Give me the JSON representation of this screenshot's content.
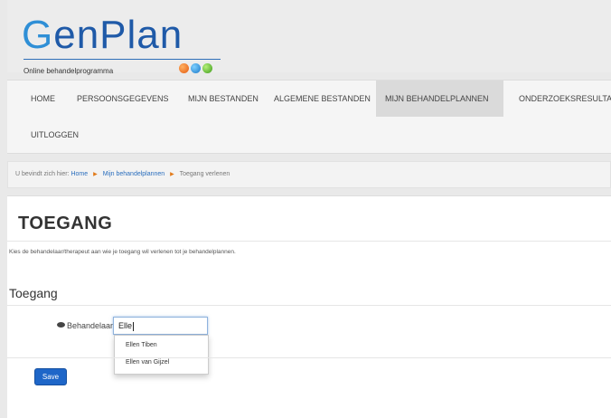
{
  "logo": {
    "word": "GenPlan",
    "word_first": "G",
    "word_rest": "enPlan",
    "tagline": "Online behandelprogramma"
  },
  "nav": {
    "items": [
      {
        "label": "HOME"
      },
      {
        "label": "PERSOONSGEGEVENS"
      },
      {
        "label": "MIJN BESTANDEN"
      },
      {
        "label": "ALGEMENE BESTANDEN"
      },
      {
        "label": "MIJN BEHANDELPLANNEN",
        "active": true
      },
      {
        "label": "ONDERZOEKSRESULTATEN"
      },
      {
        "label": "UITLOGGEN"
      }
    ]
  },
  "breadcrumb": {
    "prefix": "U bevindt zich hier:",
    "home": "Home",
    "parent": "Mijn behandelplannen",
    "current": "Toegang verlenen"
  },
  "page": {
    "title": "TOEGANG",
    "intro": "Kies de behandelaar/therapeut aan wie je toegang wil verlenen tot je behandelplannen.",
    "section_title": "Toegang"
  },
  "form": {
    "label": "Behandelaar",
    "value": "Elle",
    "suggestions": [
      "Ellen Tiben",
      "Ellen van Gijzel"
    ],
    "save_label": "Save"
  },
  "colors": {
    "accent": "#1e66c8",
    "logo_blue": "#1f5aa8",
    "crumb_separator": "#e27b1a"
  }
}
